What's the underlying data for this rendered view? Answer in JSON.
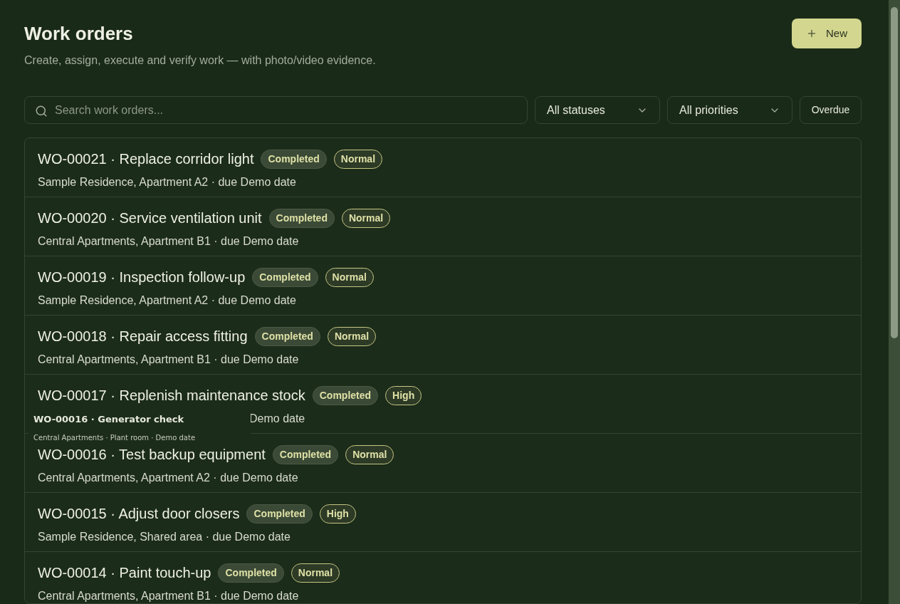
{
  "header": {
    "title": "Work orders",
    "subtitle": "Create, assign, execute and verify work — with photo/video evidence.",
    "new_button": "New"
  },
  "filters": {
    "search": {
      "placeholder": "Search work orders..."
    },
    "status": "All statuses",
    "priority": "All priorities",
    "overdue": "Overdue"
  },
  "work_orders": [
    {
      "title": "WO-00021 · Replace corridor light",
      "status": "Completed",
      "priority": "Normal",
      "subtitle": "Sample Residence, Apartment A2 · due Demo date"
    },
    {
      "title": "WO-00020 · Service ventilation unit",
      "status": "Completed",
      "priority": "Normal",
      "subtitle": "Central Apartments, Apartment B1 · due Demo date"
    },
    {
      "title": "WO-00019 · Inspection follow-up",
      "status": "Completed",
      "priority": "Normal",
      "subtitle": "Sample Residence, Apartment A2 · due Demo date"
    },
    {
      "title": "WO-00018 · Repair access fitting",
      "status": "Completed",
      "priority": "Normal",
      "subtitle": "Central Apartments, Apartment B1 · due Demo date"
    },
    {
      "title": "WO-00017 · Replenish maintenance stock",
      "status": "Completed",
      "priority": "High",
      "subtitle": "Demo date",
      "drag_preview": {
        "title": "WO-00016 · Generator check",
        "subtitle": "Central Apartments · Plant room · Demo date"
      }
    },
    {
      "title": "WO-00016 · Test backup equipment",
      "status": "Completed",
      "priority": "Normal",
      "subtitle": "Central Apartments, Apartment A2 · due Demo date"
    },
    {
      "title": "WO-00015 · Adjust door closers",
      "status": "Completed",
      "priority": "High",
      "subtitle": "Sample Residence, Shared area · due Demo date"
    },
    {
      "title": "WO-00014 · Paint touch-up",
      "status": "Completed",
      "priority": "Normal",
      "subtitle": "Central Apartments, Apartment B1 · due Demo date"
    }
  ]
}
